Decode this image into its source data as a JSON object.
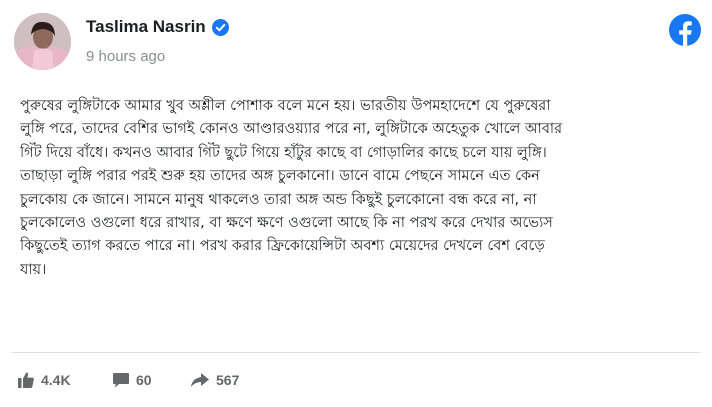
{
  "post": {
    "author": "Taslima Nasrin",
    "timestamp": "9 hours ago",
    "verified": true,
    "body_lines": [
      "পুরুষের লুঙ্গিটাকে আমার খুব অশ্লীল পোশাক বলে মনে হয়। ভারতীয় উপমহাদেশে যে পুরুষেরা",
      "লুঙ্গি পরে, তাদের বেশির ভাগই কোনও আণ্ডারওয়্যার পরে না, লুঙ্গিটাকে অহেতুক খোলে আবার",
      "গিঁট দিয়ে বাঁধে। কখনও আবার গিঁট ছুটে গিয়ে হাঁটুর কাছে বা গোড়ালির কাছে চলে যায় লুঙ্গি।",
      "তাছাড়া লুঙ্গি পরার পরই শুরু হয় তাদের অঙ্গ চুলকানো। ডানে বামে পেছনে সামনে এত কেন",
      "চুলকোয় কে জানে। সামনে মানুষ থাকলেও তারা অঙ্গ অন্ড কিছুই চুলকোনো বন্ধ করে না, না",
      "চুলকোলেও ওগুলো ধরে রাখার, বা ক্ষণে ক্ষণে ওগুলো আছে কি না পরখ করে দেখার অভ্যেস",
      "কিছুতেই ত্যাগ করতে পারে না। পরখ করার ফ্রিকোয়েন্সিটা অবশ্য মেয়েদের দেখলে বেশ বেড়ে",
      "যায়।"
    ]
  },
  "stats": {
    "likes": "4.4K",
    "comments": "60",
    "shares": "567"
  },
  "icons": {
    "brand": "facebook-logo-icon",
    "verified": "verified-badge-icon",
    "like": "thumbs-up-icon",
    "comment": "comment-bubble-icon",
    "share": "share-arrow-icon"
  },
  "colors": {
    "facebook_blue": "#1877f2",
    "muted_text": "#65676b",
    "time_text": "#8a8d91"
  }
}
